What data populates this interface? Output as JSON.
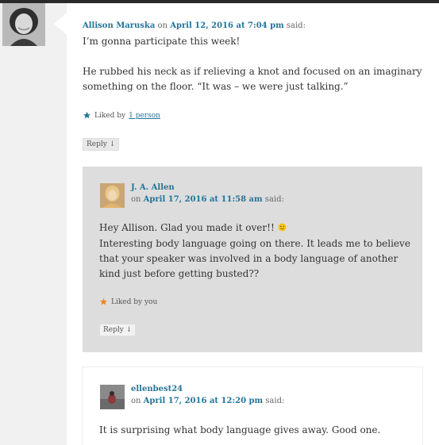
{
  "comment_main": {
    "author": "Allison Maruska",
    "on": "on",
    "date": "April 12, 2016 at 7:04 pm",
    "said": "said:",
    "para1": "I’m gonna participate this week!",
    "para2": "He rubbed his neck as if relieving a knot and focused on an imaginary something on the floor. “It was – we were just talking.”",
    "liked_prefix": "Liked by",
    "liked_link": "1 person",
    "reply": "Reply ↓"
  },
  "reply_1": {
    "author": "J. A. Allen",
    "on": "on",
    "date": "April 17, 2016 at 11:58 am",
    "said": "said:",
    "line1": "Hey Allison. Glad you made it over!!",
    "line2": "Interesting body language going on there. It leads me to believe that your speaker was involved in a body language of another kind just before getting busted??",
    "liked": "Liked by you",
    "reply": "Reply ↓"
  },
  "reply_2": {
    "author": "ellenbest24",
    "on": "on",
    "date": "April 17, 2016 at 12:20 pm",
    "said": "said:",
    "text": "It is surprising what body language gives away. Good one."
  },
  "colors": {
    "link": "#21759b",
    "star_blue": "#21759b",
    "star_orange": "#f0821e",
    "reply_bg": "#dddddd"
  }
}
